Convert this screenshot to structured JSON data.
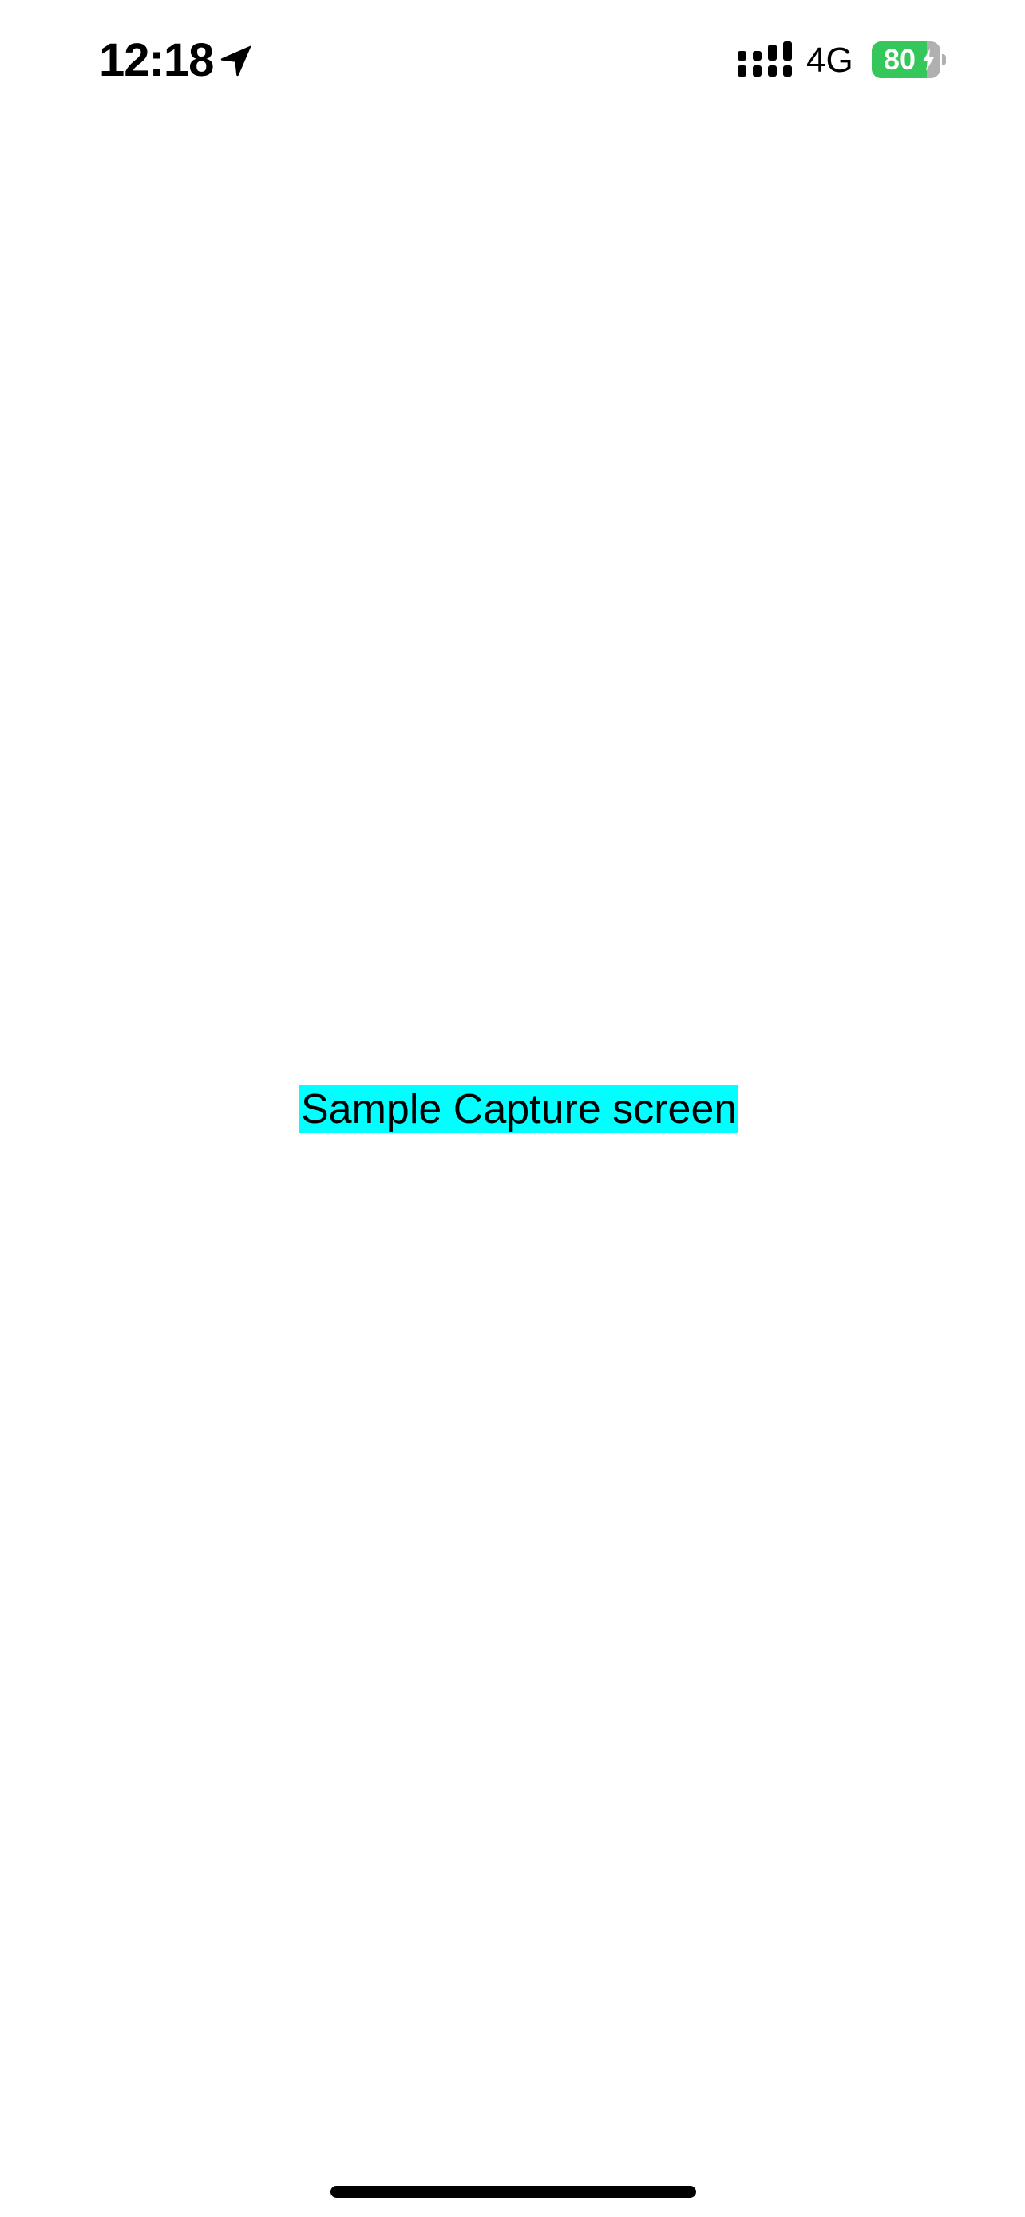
{
  "status_bar": {
    "time": "12:18",
    "location_icon": "location-arrow-icon",
    "signal_icon": "cellular-signal-icon",
    "network": "4G",
    "battery": {
      "level_text": "80",
      "level_fraction": 0.8,
      "charging_icon": "bolt-icon",
      "fill_color": "#34c759"
    }
  },
  "main": {
    "label": "Sample Capture screen",
    "label_background": "#00ffff"
  },
  "home_indicator": {
    "icon": "home-indicator-bar"
  }
}
